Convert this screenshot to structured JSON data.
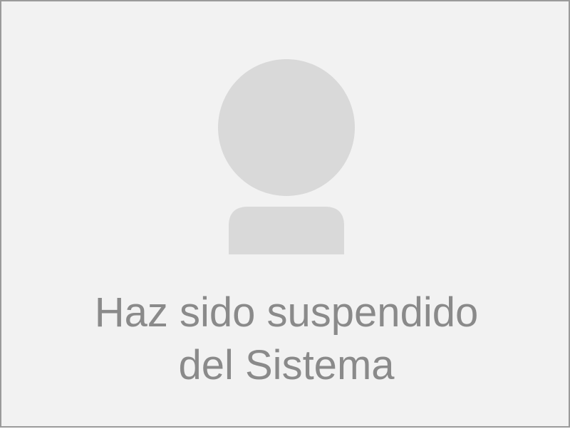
{
  "avatar": {
    "icon": "user-placeholder-icon",
    "color": "#d9d9d9"
  },
  "message": {
    "line1": "Haz sido suspendido",
    "line2": "del Sistema",
    "color": "#8a8a8a"
  },
  "background_color": "#f2f2f2",
  "border_color": "#9b9b9b"
}
